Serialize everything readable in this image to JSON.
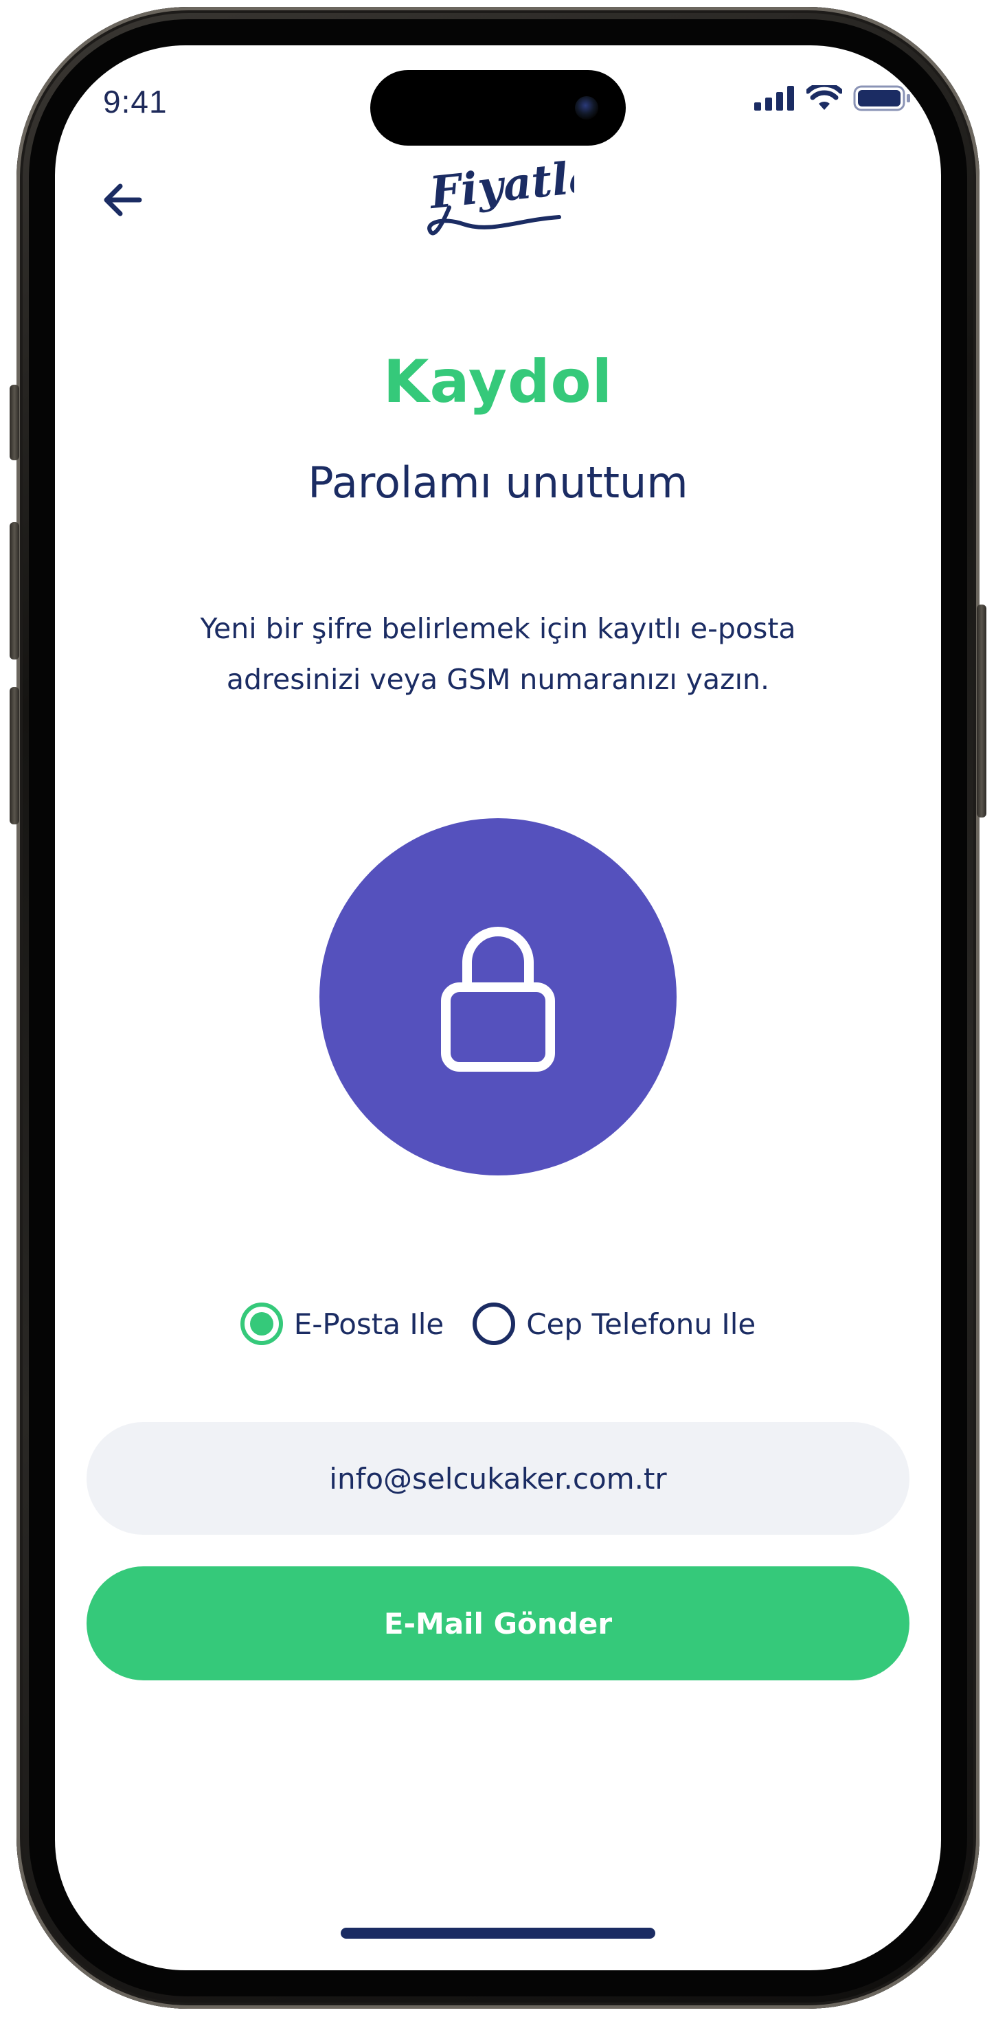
{
  "status_bar": {
    "time": "9:41",
    "signal_icon": "cellular-signal-icon",
    "wifi_icon": "wifi-icon",
    "battery_icon": "battery-icon"
  },
  "header": {
    "back_icon": "arrow-left-icon",
    "logo_text": "Fiyatla"
  },
  "main": {
    "title": "Kaydol",
    "subtitle": "Parolamı unuttum",
    "description_line1": "Yeni bir şifre belirlemek için kayıtlı e-posta",
    "description_line2": "adresinizi veya GSM numaranızı yazın.",
    "lock_icon": "lock-icon"
  },
  "method_selector": {
    "options": [
      {
        "label": "E-Posta Ile",
        "selected": true
      },
      {
        "label": "Cep Telefonu Ile",
        "selected": false
      }
    ]
  },
  "form": {
    "email_value": "info@selcukaker.com.tr",
    "submit_label": "E-Mail Gönder"
  },
  "colors": {
    "accent_green": "#35c97a",
    "navy": "#1b2c63",
    "lock_purple": "#5551bd",
    "input_bg": "#f0f2f6"
  }
}
